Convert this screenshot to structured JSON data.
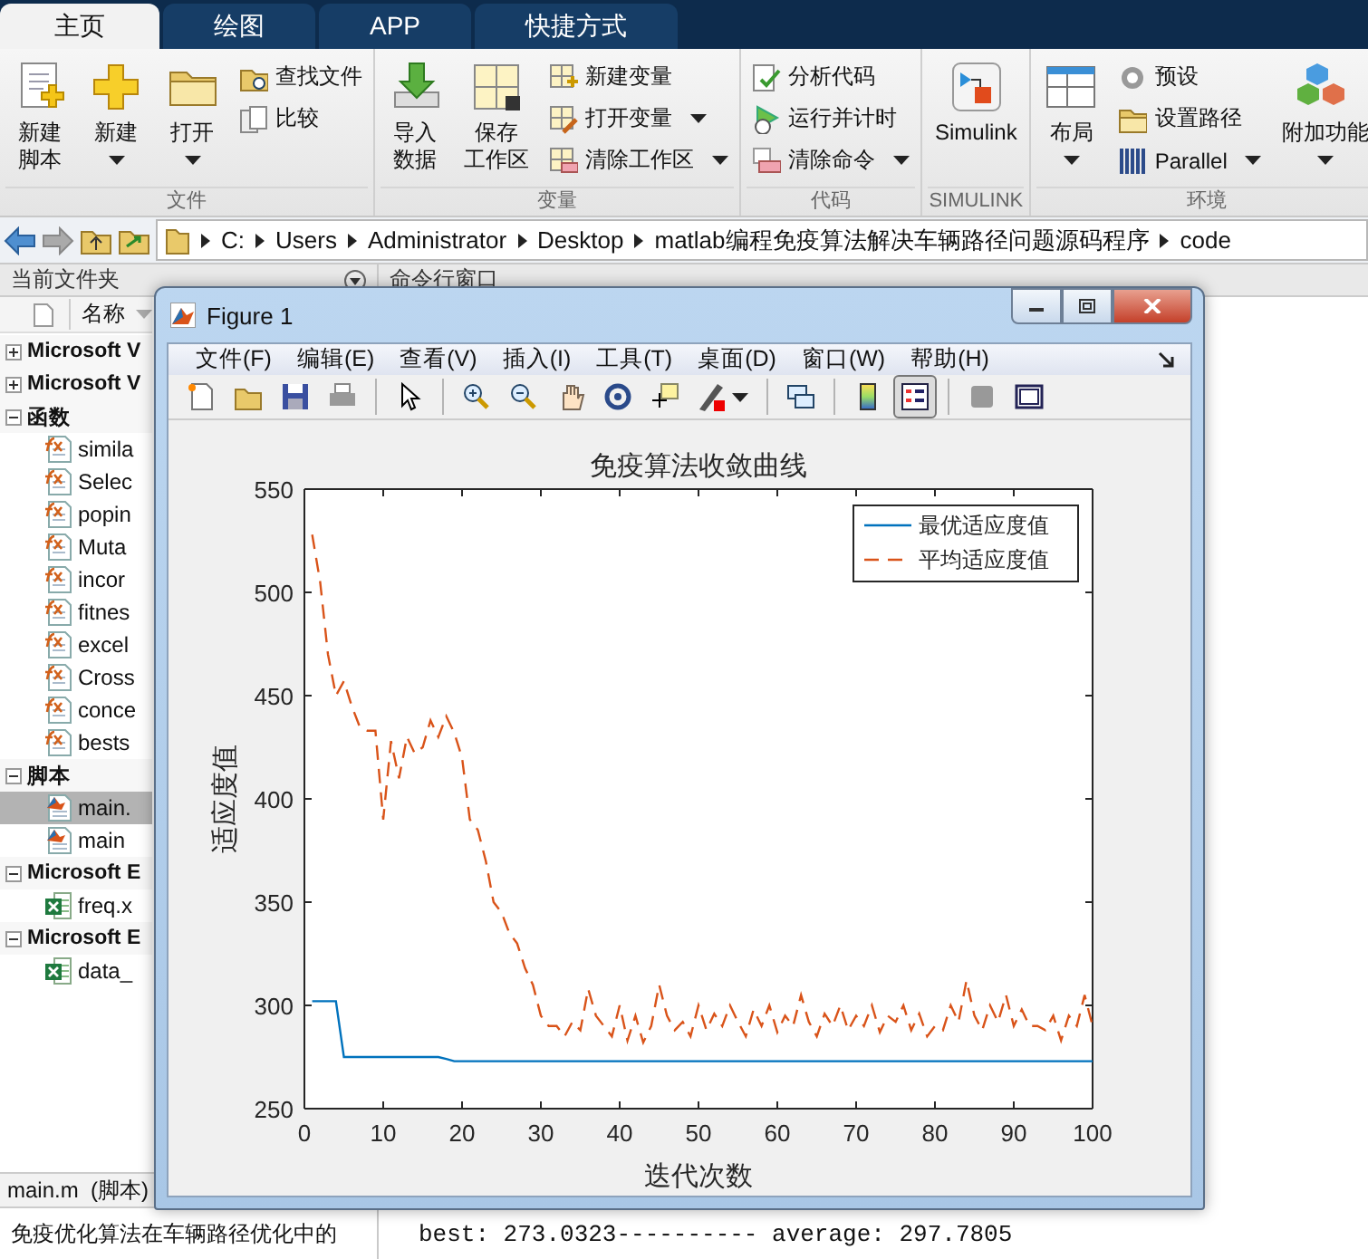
{
  "tabs": [
    {
      "label": "主页",
      "selected": true
    },
    {
      "label": "绘图",
      "selected": false
    },
    {
      "label": "APP",
      "selected": false
    },
    {
      "label": "快捷方式",
      "selected": false
    }
  ],
  "toolstrip": {
    "groups": [
      {
        "title": "文件",
        "items": [
          {
            "kind": "large",
            "lines": [
              "新建",
              "脚本"
            ],
            "dropdown": false
          },
          {
            "kind": "large",
            "lines": [
              "新建"
            ],
            "dropdown": true
          },
          {
            "kind": "large",
            "lines": [
              "打开"
            ],
            "dropdown": true
          },
          {
            "kind": "small",
            "label": "查找文件",
            "dropdown": false
          },
          {
            "kind": "small",
            "label": "比较",
            "dropdown": false
          }
        ]
      },
      {
        "title": "变量",
        "items": [
          {
            "kind": "large",
            "lines": [
              "导入",
              "数据"
            ],
            "dropdown": false
          },
          {
            "kind": "large",
            "lines": [
              "保存",
              "工作区"
            ],
            "dropdown": false
          },
          {
            "kind": "small",
            "label": "新建变量",
            "dropdown": false
          },
          {
            "kind": "small",
            "label": "打开变量",
            "dropdown": true
          },
          {
            "kind": "small",
            "label": "清除工作区",
            "dropdown": true
          }
        ]
      },
      {
        "title": "代码",
        "items": [
          {
            "kind": "small",
            "label": "分析代码",
            "dropdown": false
          },
          {
            "kind": "small",
            "label": "运行并计时",
            "dropdown": false
          },
          {
            "kind": "small",
            "label": "清除命令",
            "dropdown": true
          }
        ]
      },
      {
        "title": "SIMULINK",
        "items": [
          {
            "kind": "large",
            "lines": [
              "Simulink"
            ],
            "dropdown": false
          }
        ]
      },
      {
        "title": "环境",
        "items": [
          {
            "kind": "large",
            "lines": [
              "布局"
            ],
            "dropdown": true
          },
          {
            "kind": "small",
            "label": "预设",
            "dropdown": false
          },
          {
            "kind": "small",
            "label": "设置路径",
            "dropdown": false
          },
          {
            "kind": "small",
            "label": "Parallel",
            "dropdown": true
          },
          {
            "kind": "large",
            "lines": [
              "附加功能"
            ],
            "dropdown": true
          }
        ]
      }
    ]
  },
  "address_bar": {
    "path": [
      "C:",
      "Users",
      "Administrator",
      "Desktop",
      "matlab编程免疫算法解决车辆路径问题源码程序",
      "code"
    ]
  },
  "current_folder": {
    "title": "当前文件夹",
    "column": "名称",
    "tree": [
      {
        "label": "Microsoft V",
        "expanded": false
      },
      {
        "label": "Microsoft V",
        "expanded": false
      },
      {
        "label": "函数",
        "expanded": true,
        "children": [
          {
            "label": "simila",
            "kind": "function",
            "selected": false
          },
          {
            "label": "Selec",
            "kind": "function",
            "selected": false
          },
          {
            "label": "popin",
            "kind": "function",
            "selected": false
          },
          {
            "label": "Muta",
            "kind": "function",
            "selected": false
          },
          {
            "label": "incor",
            "kind": "function",
            "selected": false
          },
          {
            "label": "fitnes",
            "kind": "function",
            "selected": false
          },
          {
            "label": "excel",
            "kind": "function",
            "selected": false
          },
          {
            "label": "Cross",
            "kind": "function",
            "selected": false
          },
          {
            "label": "conce",
            "kind": "function",
            "selected": false
          },
          {
            "label": "bests",
            "kind": "function",
            "selected": false
          }
        ]
      },
      {
        "label": "脚本",
        "expanded": true,
        "children": [
          {
            "label": "main.",
            "kind": "script",
            "selected": true
          },
          {
            "label": "main",
            "kind": "script",
            "selected": false
          }
        ]
      },
      {
        "label": "Microsoft E",
        "expanded": true,
        "children": [
          {
            "label": "freq.x",
            "kind": "excel",
            "selected": false
          }
        ]
      },
      {
        "label": "Microsoft E",
        "expanded": true,
        "children": [
          {
            "label": "data_",
            "kind": "excel",
            "selected": false
          }
        ]
      }
    ]
  },
  "details": {
    "title": "main.m  (脚本)",
    "text": "免疫优化算法在车辆路径优化中的"
  },
  "command_window": {
    "title": "命令行窗口",
    "lines": [
      "best: 273.0323---------- average: 297.7805"
    ]
  },
  "figure": {
    "title": "Figure 1",
    "menu": [
      "文件(F)",
      "编辑(E)",
      "查看(V)",
      "插入(I)",
      "工具(T)",
      "桌面(D)",
      "窗口(W)",
      "帮助(H)"
    ],
    "toolbar": [
      {
        "kind": "button",
        "pressed": false
      },
      {
        "kind": "button",
        "pressed": false
      },
      {
        "kind": "button",
        "pressed": false
      },
      {
        "kind": "button",
        "pressed": false
      },
      {
        "kind": "separator"
      },
      {
        "kind": "button",
        "pressed": false
      },
      {
        "kind": "separator"
      },
      {
        "kind": "button",
        "pressed": false
      },
      {
        "kind": "button",
        "pressed": false
      },
      {
        "kind": "button",
        "pressed": false
      },
      {
        "kind": "button",
        "pressed": false
      },
      {
        "kind": "button",
        "pressed": false
      },
      {
        "kind": "button",
        "pressed": false
      },
      {
        "kind": "separator"
      },
      {
        "kind": "button",
        "pressed": false
      },
      {
        "kind": "separator"
      },
      {
        "kind": "button",
        "pressed": false
      },
      {
        "kind": "button",
        "pressed": true
      },
      {
        "kind": "separator"
      },
      {
        "kind": "button",
        "pressed": false
      },
      {
        "kind": "button",
        "pressed": false
      }
    ],
    "chart_data": {
      "type": "line",
      "title": "免疫算法收敛曲线",
      "xlabel": "迭代次数",
      "ylabel": "适应度值",
      "xlim": [
        0,
        100
      ],
      "ylim": [
        250,
        550
      ],
      "xticks": [
        0,
        10,
        20,
        30,
        40,
        50,
        60,
        70,
        80,
        90,
        100
      ],
      "yticks": [
        250,
        300,
        350,
        400,
        450,
        500,
        550
      ],
      "legend": true,
      "x": [
        1,
        2,
        3,
        4,
        5,
        6,
        7,
        8,
        9,
        10,
        11,
        12,
        13,
        14,
        15,
        16,
        17,
        18,
        19,
        20,
        21,
        22,
        23,
        24,
        25,
        26,
        27,
        28,
        29,
        30,
        31,
        32,
        33,
        34,
        35,
        36,
        37,
        38,
        39,
        40,
        41,
        42,
        43,
        44,
        45,
        46,
        47,
        48,
        49,
        50,
        51,
        52,
        53,
        54,
        55,
        56,
        57,
        58,
        59,
        60,
        61,
        62,
        63,
        64,
        65,
        66,
        67,
        68,
        69,
        70,
        71,
        72,
        73,
        74,
        75,
        76,
        77,
        78,
        79,
        80,
        81,
        82,
        83,
        84,
        85,
        86,
        87,
        88,
        89,
        90,
        91,
        92,
        93,
        94,
        95,
        96,
        97,
        98,
        99,
        100
      ],
      "series": [
        {
          "name": "最优适应度值",
          "color": "#0072bd",
          "line_style": "solid",
          "values": [
            302,
            302,
            302,
            302,
            275,
            275,
            275,
            275,
            275,
            275,
            275,
            275,
            275,
            275,
            275,
            275,
            275,
            274,
            273,
            273,
            273,
            273,
            273,
            273,
            273,
            273,
            273,
            273,
            273,
            273,
            273,
            273,
            273,
            273,
            273,
            273,
            273,
            273,
            273,
            273,
            273,
            273,
            273,
            273,
            273,
            273,
            273,
            273,
            273,
            273,
            273,
            273,
            273,
            273,
            273,
            273,
            273,
            273,
            273,
            273,
            273,
            273,
            273,
            273,
            273,
            273,
            273,
            273,
            273,
            273,
            273,
            273,
            273,
            273,
            273,
            273,
            273,
            273,
            273,
            273,
            273,
            273,
            273,
            273,
            273,
            273,
            273,
            273,
            273,
            273,
            273,
            273,
            273,
            273,
            273,
            273,
            273,
            273,
            273,
            273
          ]
        },
        {
          "name": "平均适应度值",
          "color": "#d95319",
          "line_style": "dashed",
          "values": [
            528,
            505,
            470,
            450,
            457,
            445,
            435,
            433,
            433,
            390,
            428,
            410,
            430,
            422,
            425,
            438,
            430,
            440,
            432,
            420,
            390,
            385,
            370,
            350,
            345,
            335,
            330,
            318,
            310,
            295,
            290,
            290,
            285,
            292,
            288,
            308,
            295,
            290,
            285,
            300,
            283,
            295,
            282,
            290,
            310,
            295,
            288,
            292,
            285,
            300,
            288,
            296,
            290,
            300,
            292,
            285,
            298,
            290,
            300,
            287,
            295,
            290,
            305,
            292,
            285,
            296,
            290,
            300,
            288,
            295,
            290,
            300,
            287,
            295,
            292,
            300,
            288,
            296,
            285,
            290,
            288,
            300,
            292,
            312,
            295,
            288,
            300,
            292,
            305,
            290,
            298,
            290,
            290,
            288,
            295,
            283,
            295,
            290,
            305,
            290
          ]
        }
      ]
    }
  }
}
